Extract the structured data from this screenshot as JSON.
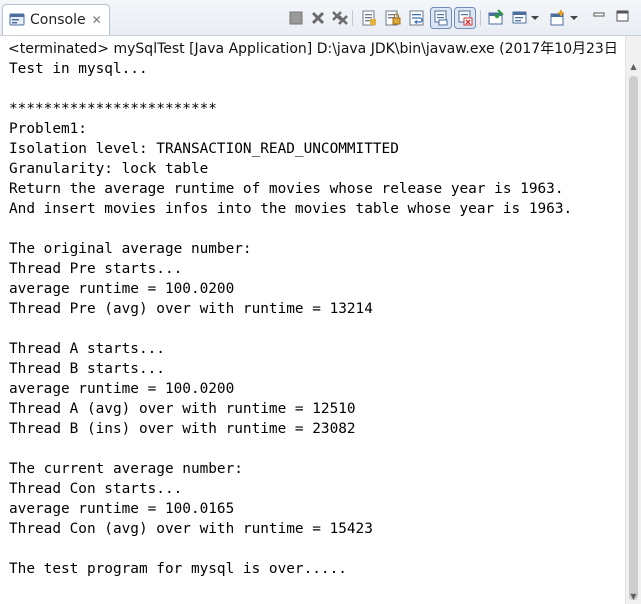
{
  "view": {
    "tab_label": "Console",
    "tab_icon": "console-icon",
    "close_glyph": "✕"
  },
  "toolbar": {
    "icons": [
      "terminate-icon",
      "remove-launch-icon",
      "remove-all-terminated-icon",
      "clear-console-icon",
      "scroll-lock-icon",
      "word-wrap-icon",
      "show-on-stdout-icon",
      "show-on-stderr-icon",
      "pin-console-icon",
      "display-selected-console-icon",
      "open-console-icon",
      "minimize-icon",
      "maximize-icon"
    ]
  },
  "status": {
    "text": "<terminated> mySqlTest [Java Application] D:\\java JDK\\bin\\javaw.exe (2017年10月23日"
  },
  "console": {
    "lines": [
      "Test in mysql...",
      "",
      "************************",
      "Problem1:",
      "Isolation level: TRANSACTION_READ_UNCOMMITTED",
      "Granularity: lock table",
      "Return the average runtime of movies whose release year is 1963.",
      "And insert movies infos into the movies table whose year is 1963.",
      "",
      "The original average number:",
      "Thread Pre starts...",
      "average runtime = 100.0200",
      "Thread Pre (avg) over with runtime = 13214",
      "",
      "Thread A starts...",
      "Thread B starts...",
      "average runtime = 100.0200",
      "Thread A (avg) over with runtime = 12510",
      "Thread B (ins) over with runtime = 23082",
      "",
      "The current average number:",
      "Thread Con starts...",
      "average runtime = 100.0165",
      "Thread Con (avg) over with runtime = 15423",
      "",
      "The test program for mysql is over....."
    ]
  },
  "colors": {
    "toolbar_bg": "#e9edf3",
    "accent_blue": "#3b6fb6",
    "terminate_gray": "#8c8c8c"
  }
}
